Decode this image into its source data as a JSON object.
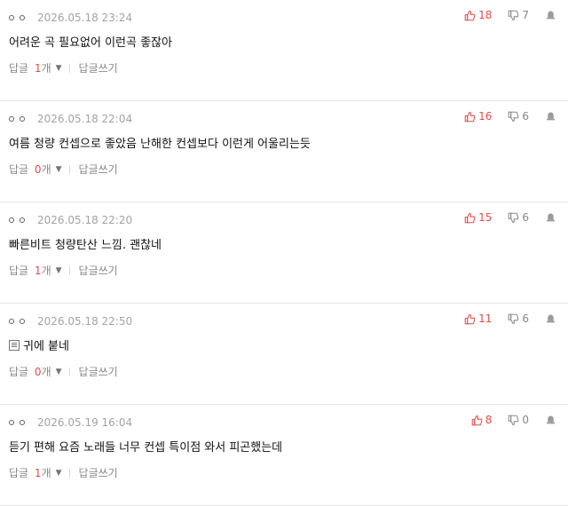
{
  "colors": {
    "accent": "#e34b4b",
    "muted": "#888888",
    "divider": "#e6e6e6"
  },
  "comments": [
    {
      "time": "2026.05.18 23:24",
      "text": "어려운 곡 필요없어 이런곡 좋잖아",
      "has_emoticon": false,
      "likes": "18",
      "dislikes": "7",
      "reply_label": "답글",
      "reply_count": "1",
      "reply_unit": "개",
      "reply_write": "답글쓰기"
    },
    {
      "time": "2026.05.18 22:04",
      "text": "여름 청량 컨셉으로 좋았음 난해한 컨셉보다 이런게 어울리는듯",
      "has_emoticon": false,
      "likes": "16",
      "dislikes": "6",
      "reply_label": "답글",
      "reply_count": "0",
      "reply_unit": "개",
      "reply_write": "답글쓰기"
    },
    {
      "time": "2026.05.18 22:20",
      "text": "빠른비트 청량탄산 느낌. 괜찮네",
      "has_emoticon": false,
      "likes": "15",
      "dislikes": "6",
      "reply_label": "답글",
      "reply_count": "1",
      "reply_unit": "개",
      "reply_write": "답글쓰기"
    },
    {
      "time": "2026.05.18 22:50",
      "text": "귀에 붙네",
      "has_emoticon": true,
      "likes": "11",
      "dislikes": "6",
      "reply_label": "답글",
      "reply_count": "0",
      "reply_unit": "개",
      "reply_write": "답글쓰기"
    },
    {
      "time": "2026.05.19 16:04",
      "text": "듣기 편해 요즘 노래들 너무 컨셉 특이점 와서 피곤했는데",
      "has_emoticon": false,
      "likes": "8",
      "dislikes": "0",
      "reply_label": "답글",
      "reply_count": "1",
      "reply_unit": "개",
      "reply_write": "답글쓰기"
    }
  ]
}
